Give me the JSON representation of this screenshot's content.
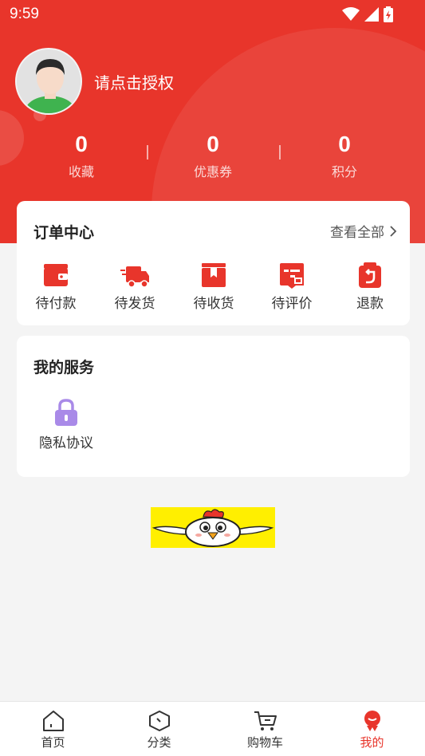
{
  "status_bar": {
    "time": "9:59"
  },
  "profile": {
    "name": "请点击授权"
  },
  "stats": [
    {
      "value": "0",
      "label": "收藏"
    },
    {
      "value": "0",
      "label": "优惠券"
    },
    {
      "value": "0",
      "label": "积分"
    }
  ],
  "orders": {
    "title": "订单中心",
    "view_all": "查看全部",
    "items": [
      {
        "label": "待付款",
        "icon": "wallet-icon"
      },
      {
        "label": "待发货",
        "icon": "truck-icon"
      },
      {
        "label": "待收货",
        "icon": "package-icon"
      },
      {
        "label": "待评价",
        "icon": "comment-icon"
      },
      {
        "label": "退款",
        "icon": "refund-icon"
      }
    ]
  },
  "services": {
    "title": "我的服务",
    "items": [
      {
        "label": "隐私协议",
        "icon": "lock-icon"
      }
    ]
  },
  "tabs": [
    {
      "label": "首页",
      "icon": "home-icon"
    },
    {
      "label": "分类",
      "icon": "category-icon"
    },
    {
      "label": "购物车",
      "icon": "cart-icon"
    },
    {
      "label": "我的",
      "icon": "profile-icon",
      "active": true
    }
  ],
  "colors": {
    "brand": "#e8352b",
    "page_bg": "#f4f4f4",
    "lock": "#a98ae8"
  }
}
